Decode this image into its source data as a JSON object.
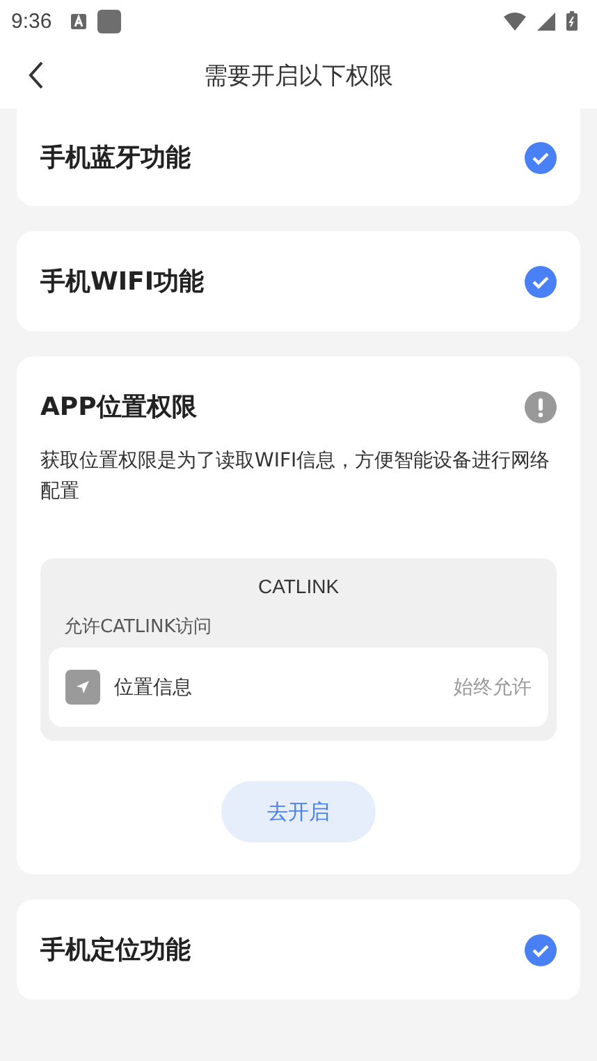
{
  "status_bar": {
    "time": "9:36"
  },
  "header": {
    "title": "需要开启以下权限"
  },
  "cards": [
    {
      "kind": "toggle",
      "title": "手机蓝牙功能",
      "checked": true,
      "cut_top": true
    },
    {
      "kind": "toggle",
      "title": "手机WIFI功能",
      "checked": true
    },
    {
      "kind": "permission",
      "title": "APP位置权限",
      "warning": true,
      "description": "获取位置权限是为了读取WIFI信息，方便智能设备进行网络配置",
      "dialog": {
        "app": "CATLINK",
        "prompt": "允许CATLINK访问",
        "item": "位置信息",
        "value": "始终允许"
      },
      "button": "去开启"
    },
    {
      "kind": "toggle",
      "title": "手机定位功能",
      "checked": true
    }
  ]
}
